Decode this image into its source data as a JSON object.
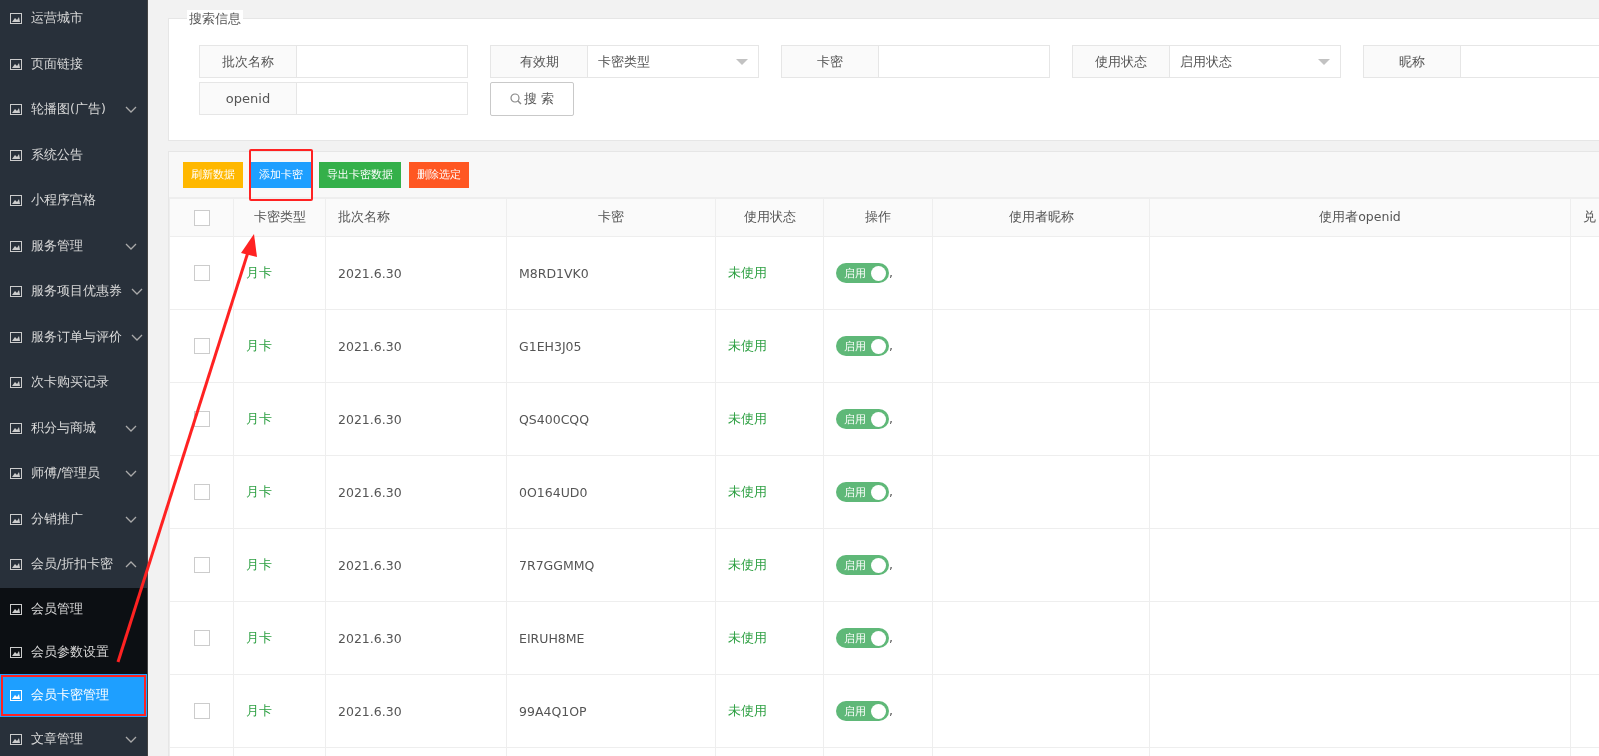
{
  "sidebar": {
    "items": [
      {
        "label": "运营城市"
      },
      {
        "label": "页面链接"
      },
      {
        "label": "轮播图(广告)",
        "expanded": false
      },
      {
        "label": "系统公告"
      },
      {
        "label": "小程序宫格"
      },
      {
        "label": "服务管理",
        "expanded": false
      },
      {
        "label": "服务项目优惠券",
        "expanded": false
      },
      {
        "label": "服务订单与评价",
        "expanded": false
      },
      {
        "label": "次卡购买记录"
      },
      {
        "label": "积分与商城",
        "expanded": false
      },
      {
        "label": "师傅/管理员",
        "expanded": false
      },
      {
        "label": "分销推广",
        "expanded": false
      },
      {
        "label": "会员/折扣卡密",
        "expanded": true,
        "children": [
          {
            "label": "会员管理",
            "selected": false,
            "highlighted": false
          },
          {
            "label": "会员参数设置",
            "selected": false,
            "highlighted": false
          },
          {
            "label": "会员卡密管理",
            "selected": true,
            "highlighted": true
          }
        ]
      },
      {
        "label": "文章管理",
        "expanded": false
      }
    ]
  },
  "search": {
    "legend": "搜索信息",
    "fields": [
      {
        "kind": "input",
        "label": "批次名称"
      },
      {
        "kind": "select",
        "label": "有效期",
        "value": "卡密类型"
      },
      {
        "kind": "input",
        "label": "卡密"
      },
      {
        "kind": "select",
        "label": "使用状态",
        "value": "启用状态"
      },
      {
        "kind": "input",
        "label": "昵称"
      },
      {
        "kind": "input",
        "label": "openid"
      }
    ],
    "button": "搜 索"
  },
  "toolbar": {
    "buttons": [
      {
        "label": "刷新数据",
        "color": "#ffb800",
        "highlighted": false
      },
      {
        "label": "添加卡密",
        "color": "#1e9fff",
        "highlighted": true
      },
      {
        "label": "导出卡密数据",
        "color": "#34b04a",
        "highlighted": false
      },
      {
        "label": "删除选定",
        "color": "#ff5722",
        "highlighted": false
      }
    ]
  },
  "table": {
    "columns": [
      "卡密类型",
      "批次名称",
      "卡密",
      "使用状态",
      "操作",
      "使用者昵称",
      "使用者openid",
      "兑"
    ],
    "header_checked": false,
    "rows": [
      {
        "checked": false,
        "type": "月卡",
        "batch": "2021.6.30",
        "code": "M8RD1VK0",
        "status": "未使用",
        "toggle": "启用",
        "on": true,
        "separator": ","
      },
      {
        "checked": false,
        "type": "月卡",
        "batch": "2021.6.30",
        "code": "G1EH3J05",
        "status": "未使用",
        "toggle": "启用",
        "on": true,
        "separator": ","
      },
      {
        "checked": false,
        "type": "月卡",
        "batch": "2021.6.30",
        "code": "QS400CQQ",
        "status": "未使用",
        "toggle": "启用",
        "on": true,
        "separator": ","
      },
      {
        "checked": false,
        "type": "月卡",
        "batch": "2021.6.30",
        "code": "0O164UD0",
        "status": "未使用",
        "toggle": "启用",
        "on": true,
        "separator": ","
      },
      {
        "checked": false,
        "type": "月卡",
        "batch": "2021.6.30",
        "code": "7R7GGMMQ",
        "status": "未使用",
        "toggle": "启用",
        "on": true,
        "separator": ","
      },
      {
        "checked": false,
        "type": "月卡",
        "batch": "2021.6.30",
        "code": "EIRUH8ME",
        "status": "未使用",
        "toggle": "启用",
        "on": true,
        "separator": ","
      },
      {
        "checked": false,
        "type": "月卡",
        "batch": "2021.6.30",
        "code": "99A4Q1OP",
        "status": "未使用",
        "toggle": "启用",
        "on": true,
        "separator": ","
      }
    ]
  }
}
